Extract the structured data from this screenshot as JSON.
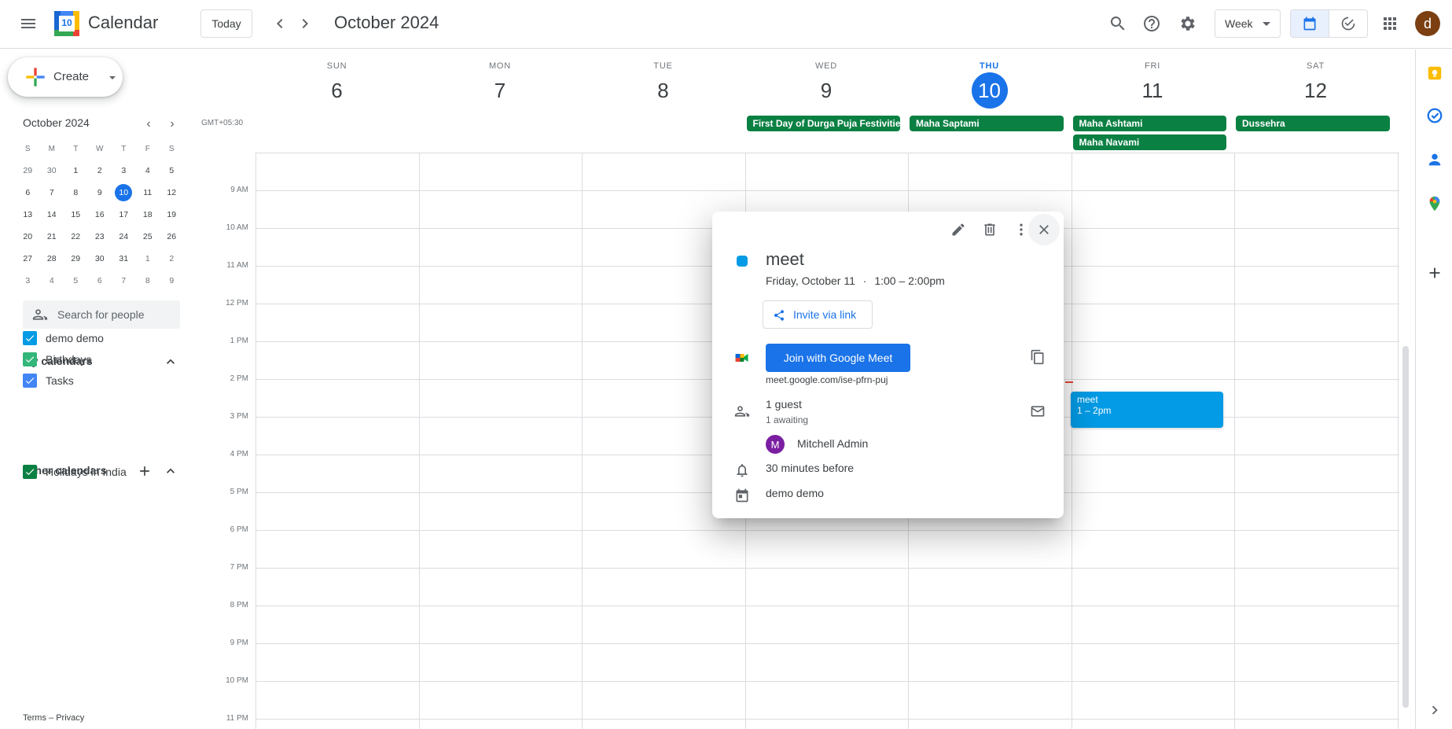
{
  "header": {
    "app_title": "Calendar",
    "logo_number": "10",
    "today_label": "Today",
    "month_title": "October 2024",
    "view_label": "Week",
    "avatar_letter": "d"
  },
  "sidebar": {
    "create_label": "Create",
    "mini_calendar": {
      "title": "October 2024",
      "weekday_heads": [
        "S",
        "M",
        "T",
        "W",
        "T",
        "F",
        "S"
      ],
      "weeks": [
        [
          "29",
          "30",
          "1",
          "2",
          "3",
          "4",
          "5"
        ],
        [
          "6",
          "7",
          "8",
          "9",
          "10",
          "11",
          "12"
        ],
        [
          "13",
          "14",
          "15",
          "16",
          "17",
          "18",
          "19"
        ],
        [
          "20",
          "21",
          "22",
          "23",
          "24",
          "25",
          "26"
        ],
        [
          "27",
          "28",
          "29",
          "30",
          "31",
          "1",
          "2"
        ],
        [
          "3",
          "4",
          "5",
          "6",
          "7",
          "8",
          "9"
        ]
      ],
      "today": "10"
    },
    "search_people_placeholder": "Search for people",
    "my_calendars_title": "My calendars",
    "my_calendars": [
      {
        "label": "demo demo",
        "color": "#039be5"
      },
      {
        "label": "Birthdays",
        "color": "#33b679"
      },
      {
        "label": "Tasks",
        "color": "#4285f4"
      }
    ],
    "other_calendars_title": "Other calendars",
    "other_calendars": [
      {
        "label": "Holidays in India",
        "color": "#0b8043"
      }
    ],
    "footer_terms": "Terms",
    "footer_sep": "–",
    "footer_privacy": "Privacy"
  },
  "week": {
    "timezone": "GMT+05:30",
    "days": [
      {
        "name": "SUN",
        "num": "6"
      },
      {
        "name": "MON",
        "num": "7"
      },
      {
        "name": "TUE",
        "num": "8"
      },
      {
        "name": "WED",
        "num": "9"
      },
      {
        "name": "THU",
        "num": "10"
      },
      {
        "name": "FRI",
        "num": "11"
      },
      {
        "name": "SAT",
        "num": "12"
      }
    ],
    "hours": [
      "9 AM",
      "10 AM",
      "11 AM",
      "12 PM",
      "1 PM",
      "2 PM",
      "3 PM",
      "4 PM",
      "5 PM",
      "6 PM",
      "7 PM",
      "8 PM",
      "9 PM",
      "10 PM",
      "11 PM"
    ],
    "allday_events": [
      {
        "title": "First Day of Durga Puja Festivities",
        "day": "WED"
      },
      {
        "title": "Maha Saptami",
        "day": "THU"
      },
      {
        "title": "Maha Ashtami",
        "day": "FRI"
      },
      {
        "title": "Maha Navami",
        "day": "FRI"
      },
      {
        "title": "Dussehra",
        "day": "SAT"
      }
    ],
    "timed_event": {
      "title": "meet",
      "time": "1 – 2pm",
      "day": "FRI"
    }
  },
  "popup": {
    "title": "meet",
    "date": "Friday, October 11",
    "dot": "·",
    "time": "1:00 – 2:00pm",
    "invite_label": "Invite via link",
    "meet_button": "Join with Google Meet",
    "meet_url": "meet.google.com/ise-pfrn-puj",
    "guests_count": "1 guest",
    "guests_status": "1 awaiting",
    "guest_name": "Mitchell Admin",
    "guest_initial": "M",
    "reminder": "30 minutes before",
    "calendar": "demo demo"
  },
  "colors": {
    "accent": "#1a73e8",
    "holiday": "#0b8043",
    "event": "#039be5"
  }
}
